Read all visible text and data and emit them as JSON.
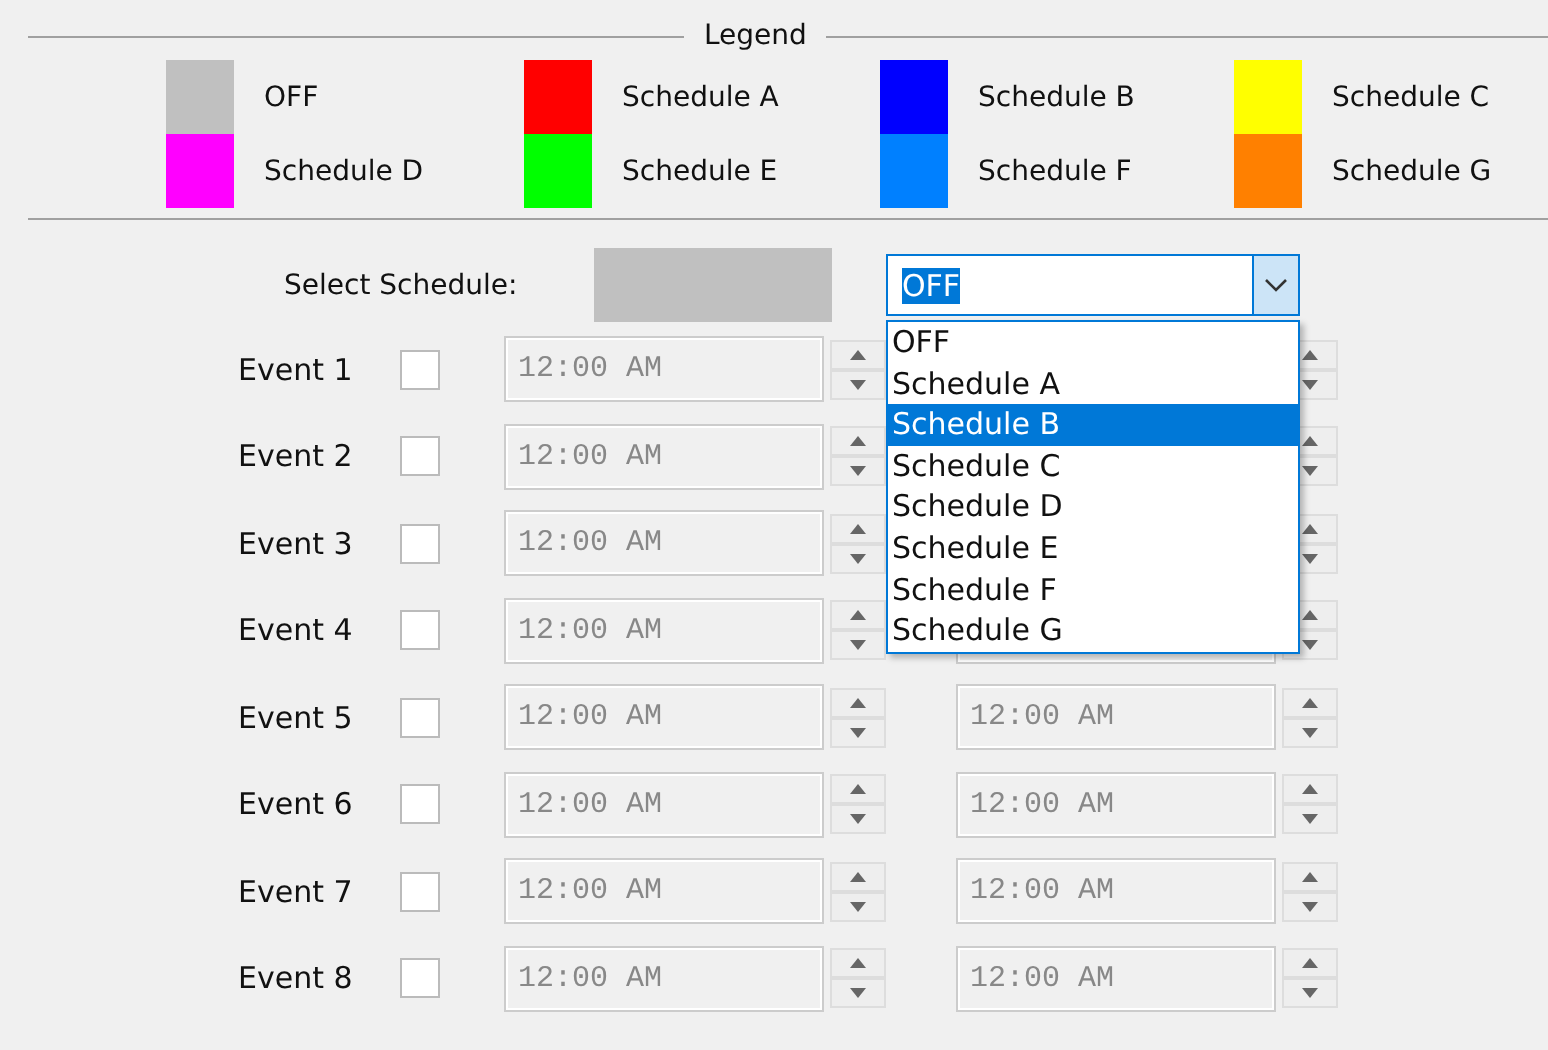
{
  "legend": {
    "title": "Legend",
    "items": [
      {
        "label": "OFF",
        "color": "#c0c0c0"
      },
      {
        "label": "Schedule A",
        "color": "#ff0000"
      },
      {
        "label": "Schedule B",
        "color": "#0000ff"
      },
      {
        "label": "Schedule C",
        "color": "#ffff00"
      },
      {
        "label": "Schedule D",
        "color": "#ff00ff"
      },
      {
        "label": "Schedule E",
        "color": "#00ff00"
      },
      {
        "label": "Schedule F",
        "color": "#0080ff"
      },
      {
        "label": "Schedule G",
        "color": "#ff8000"
      }
    ]
  },
  "select": {
    "label": "Select Schedule:",
    "swatch": {
      "color": "#c0c0c0"
    },
    "value": "OFF",
    "expanded": true,
    "options": [
      {
        "label": "OFF",
        "highlighted": false
      },
      {
        "label": "Schedule A",
        "highlighted": false
      },
      {
        "label": "Schedule B",
        "highlighted": true
      },
      {
        "label": "Schedule C",
        "highlighted": false
      },
      {
        "label": "Schedule D",
        "highlighted": false
      },
      {
        "label": "Schedule E",
        "highlighted": false
      },
      {
        "label": "Schedule F",
        "highlighted": false
      },
      {
        "label": "Schedule G",
        "highlighted": false
      }
    ]
  },
  "events": [
    {
      "label": "Event 1",
      "checked": false,
      "disabled": true,
      "start": "12:00 AM"
    },
    {
      "label": "Event 2",
      "checked": false,
      "disabled": true,
      "start": "12:00 AM"
    },
    {
      "label": "Event 3",
      "checked": false,
      "disabled": true,
      "start": "12:00 AM"
    },
    {
      "label": "Event 4",
      "checked": false,
      "disabled": true,
      "start": "12:00 AM"
    },
    {
      "label": "Event 5",
      "checked": false,
      "disabled": true,
      "start": "12:00 AM",
      "end": "12:00 AM"
    },
    {
      "label": "Event 6",
      "checked": false,
      "disabled": true,
      "start": "12:00 AM",
      "end": "12:00 AM"
    },
    {
      "label": "Event 7",
      "checked": false,
      "disabled": true,
      "start": "12:00 AM",
      "end": "12:00 AM"
    },
    {
      "label": "Event 8",
      "checked": false,
      "disabled": true,
      "start": "12:00 AM",
      "end": "12:00 AM"
    }
  ]
}
